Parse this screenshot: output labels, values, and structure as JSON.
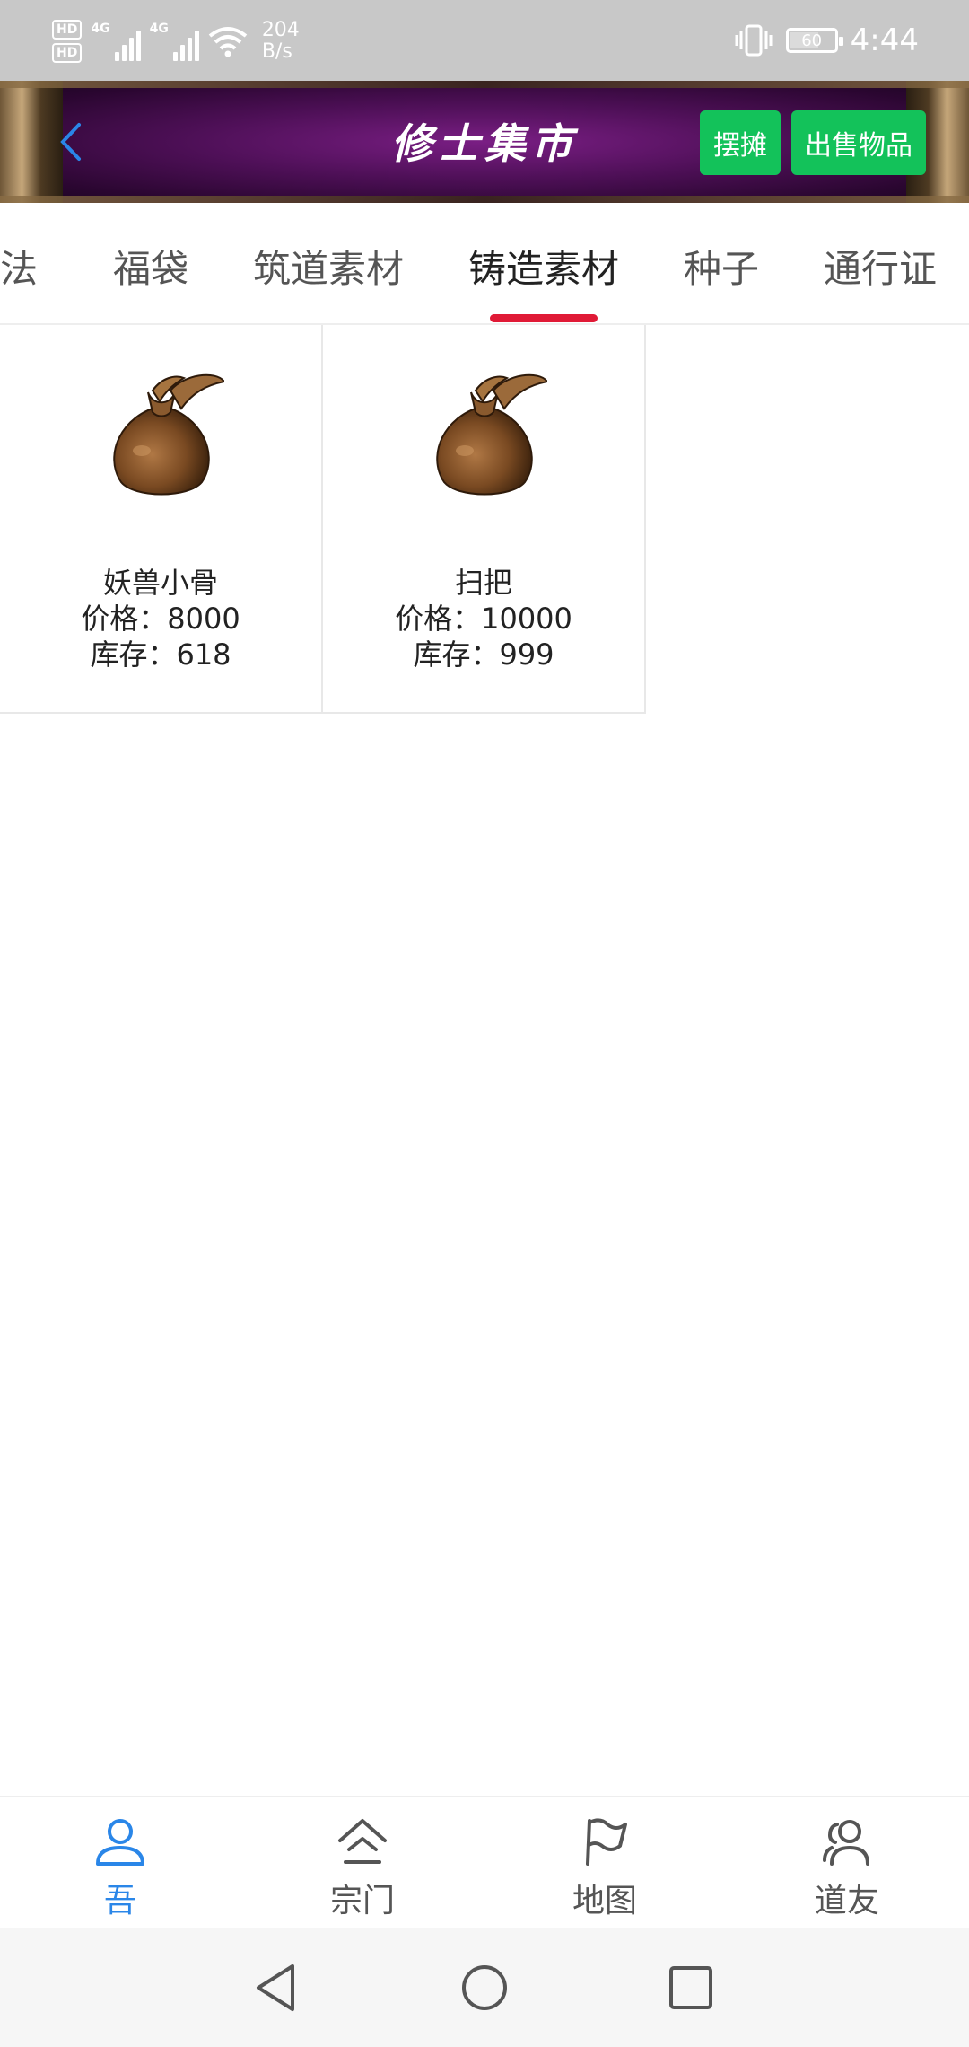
{
  "status_bar": {
    "hd1": "HD",
    "hd2": "HD",
    "net1": "4G",
    "net2": "4G",
    "speed_value": "204",
    "speed_unit": "B/s",
    "battery": "60",
    "time": "4:44"
  },
  "header": {
    "title": "修士集市",
    "stall_button": "摆摊",
    "sell_button": "出售物品"
  },
  "tabs": [
    {
      "label": "功法",
      "active": false
    },
    {
      "label": "福袋",
      "active": false
    },
    {
      "label": "筑道素材",
      "active": false
    },
    {
      "label": "铸造素材",
      "active": true
    },
    {
      "label": "种子",
      "active": false
    },
    {
      "label": "通行证",
      "active": false
    }
  ],
  "items": [
    {
      "name": "妖兽小骨",
      "price": "价格：8000",
      "stock": "库存：618",
      "icon": "bag-icon"
    },
    {
      "name": "扫把",
      "price": "价格：10000",
      "stock": "库存：999",
      "icon": "bag-icon"
    }
  ],
  "bottom_nav": [
    {
      "label": "吾",
      "icon": "person-icon",
      "active": true
    },
    {
      "label": "宗门",
      "icon": "home-icon",
      "active": false
    },
    {
      "label": "地图",
      "icon": "flag-icon",
      "active": false
    },
    {
      "label": "道友",
      "icon": "friends-icon",
      "active": false
    }
  ],
  "colors": {
    "accent_green": "#13c25a",
    "tab_indicator": "#e01a36",
    "nav_active": "#2a86e8"
  }
}
